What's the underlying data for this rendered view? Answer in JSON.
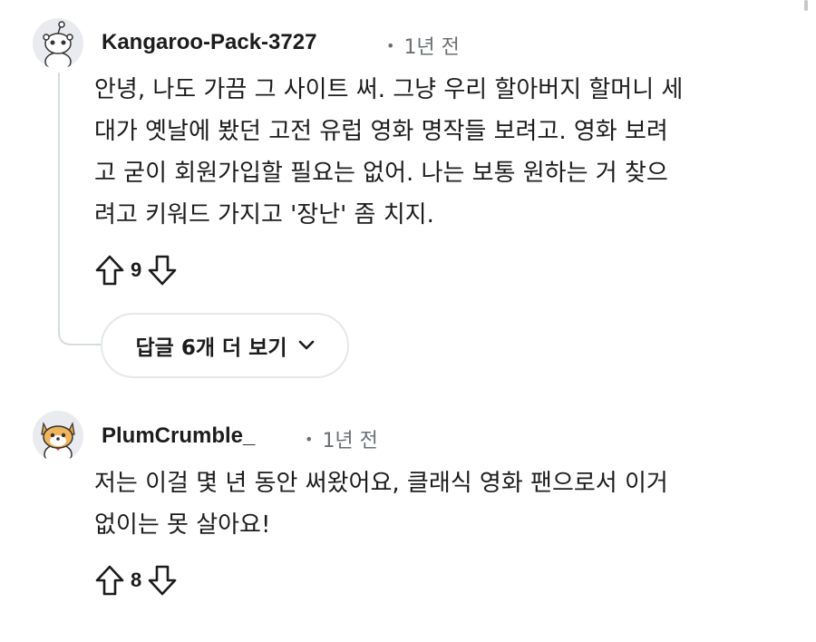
{
  "comments": [
    {
      "author": "Kangaroo-Pack-3727",
      "time": "1년 전",
      "avatar_icon": "snoo-avatar-icon",
      "lines": [
        "안녕, 나도 가끔 그 사이트 써. 그냥 우리 할아버지 할머니 세",
        "대가 옛날에 봤던 고전 유럽 영화 명작들 보려고. 영화 보려",
        "고 굳이 회원가입할 필요는 없어. 나는 보통 원하는 거 찾으",
        "려고 키워드 가지고 '장난' 좀 치지."
      ],
      "score": "9",
      "more_replies_label": "답글 6개 더 보기"
    },
    {
      "author": "PlumCrumble_",
      "time": "1년 전",
      "avatar_icon": "shiba-avatar-icon",
      "lines": [
        "저는 이걸 몇 년 동안 써왔어요, 클래식 영화 팬으로서 이거",
        "없이는 못 살아요!"
      ],
      "score": "8"
    }
  ],
  "colors": {
    "text": "#1c1c1c",
    "meta": "#6b6f73",
    "thread_line": "#d9dcdf",
    "button_border": "#e5e7ea"
  }
}
